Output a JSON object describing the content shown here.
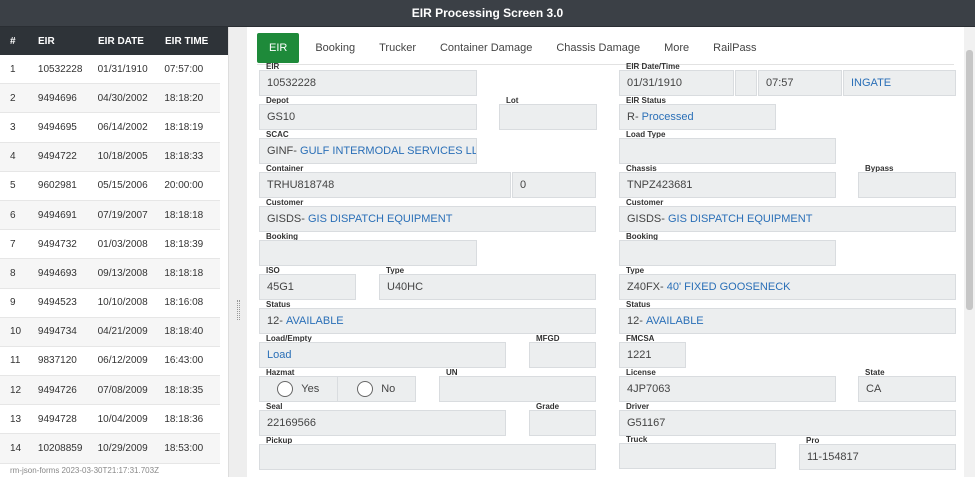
{
  "window": {
    "title": "EIR Processing Screen 3.0"
  },
  "list": {
    "headers": {
      "num": "#",
      "eir": "EIR",
      "date": "EIR DATE",
      "time": "EIR TIME"
    },
    "rows": [
      {
        "num": "1",
        "eir": "10532228",
        "date": "01/31/1910",
        "time": "07:57:00"
      },
      {
        "num": "2",
        "eir": "9494696",
        "date": "04/30/2002",
        "time": "18:18:20"
      },
      {
        "num": "3",
        "eir": "9494695",
        "date": "06/14/2002",
        "time": "18:18:19"
      },
      {
        "num": "4",
        "eir": "9494722",
        "date": "10/18/2005",
        "time": "18:18:33"
      },
      {
        "num": "5",
        "eir": "9602981",
        "date": "05/15/2006",
        "time": "20:00:00"
      },
      {
        "num": "6",
        "eir": "9494691",
        "date": "07/19/2007",
        "time": "18:18:18"
      },
      {
        "num": "7",
        "eir": "9494732",
        "date": "01/03/2008",
        "time": "18:18:39"
      },
      {
        "num": "8",
        "eir": "9494693",
        "date": "09/13/2008",
        "time": "18:18:18"
      },
      {
        "num": "9",
        "eir": "9494523",
        "date": "10/10/2008",
        "time": "18:16:08"
      },
      {
        "num": "10",
        "eir": "9494734",
        "date": "04/21/2009",
        "time": "18:18:40"
      },
      {
        "num": "11",
        "eir": "9837120",
        "date": "06/12/2009",
        "time": "16:43:00"
      },
      {
        "num": "12",
        "eir": "9494726",
        "date": "07/08/2009",
        "time": "18:18:35"
      },
      {
        "num": "13",
        "eir": "9494728",
        "date": "10/04/2009",
        "time": "18:18:36"
      },
      {
        "num": "14",
        "eir": "10208859",
        "date": "10/29/2009",
        "time": "18:53:00"
      }
    ],
    "footer": "rm-json-forms 2023-03-30T21:17:31.703Z"
  },
  "tabs": [
    "EIR",
    "Booking",
    "Trucker",
    "Container Damage",
    "Chassis Damage",
    "More",
    "RailPass"
  ],
  "form": {
    "eir": {
      "label": "EIR",
      "value": "10532228"
    },
    "eir_datetime": {
      "label": "EIR Date/Time",
      "date": "01/31/1910",
      "time": "07:57",
      "direction": "INGATE"
    },
    "depot": {
      "label": "Depot",
      "value": "GS10"
    },
    "lot": {
      "label": "Lot",
      "value": ""
    },
    "eir_status": {
      "label": "EIR Status",
      "code": "R-",
      "desc": "Processed"
    },
    "scac": {
      "label": "SCAC",
      "code": "GINF-",
      "desc": "GULF INTERMODAL SERVICES LLC,..."
    },
    "load_type": {
      "label": "Load Type",
      "value": ""
    },
    "container": {
      "label": "Container",
      "value": "TRHU818748",
      "check": "0"
    },
    "chassis": {
      "label": "Chassis",
      "value": "TNPZ423681"
    },
    "bypass": {
      "label": "Bypass",
      "value": ""
    },
    "customer_left": {
      "label": "Customer",
      "code": "GISDS-",
      "desc": "GIS DISPATCH EQUIPMENT"
    },
    "customer_right": {
      "label": "Customer",
      "code": "GISDS-",
      "desc": "GIS DISPATCH EQUIPMENT"
    },
    "booking_left": {
      "label": "Booking",
      "value": ""
    },
    "booking_right": {
      "label": "Booking",
      "value": ""
    },
    "iso": {
      "label": "ISO",
      "value": "45G1"
    },
    "type_left": {
      "label": "Type",
      "value": "U40HC"
    },
    "type_right": {
      "label": "Type",
      "code": "Z40FX-",
      "desc": "40' FIXED GOOSENECK"
    },
    "status_left": {
      "label": "Status",
      "code": "12-",
      "desc": "AVAILABLE"
    },
    "status_right": {
      "label": "Status",
      "code": "12-",
      "desc": "AVAILABLE"
    },
    "load_empty": {
      "label": "Load/Empty",
      "value": "Load"
    },
    "mfgd": {
      "label": "MFGD",
      "value": ""
    },
    "fmcsa": {
      "label": "FMCSA",
      "value": "1221"
    },
    "hazmat": {
      "label": "Hazmat",
      "yes": "Yes",
      "no": "No"
    },
    "un": {
      "label": "UN",
      "value": ""
    },
    "license": {
      "label": "License",
      "value": "4JP7063"
    },
    "state": {
      "label": "State",
      "value": "CA"
    },
    "seal": {
      "label": "Seal",
      "value": "22169566"
    },
    "grade": {
      "label": "Grade",
      "value": ""
    },
    "driver": {
      "label": "Driver",
      "value": "G51167"
    },
    "pickup": {
      "label": "Pickup",
      "value": ""
    },
    "truck": {
      "label": "Truck",
      "value": ""
    },
    "pro": {
      "label": "Pro",
      "value": "11-154817"
    }
  },
  "colors": {
    "titlebar": "#3b4046",
    "active_tab": "#1e8a3a",
    "link_blue": "#2a6fb7",
    "field_bg": "#eceeef"
  }
}
